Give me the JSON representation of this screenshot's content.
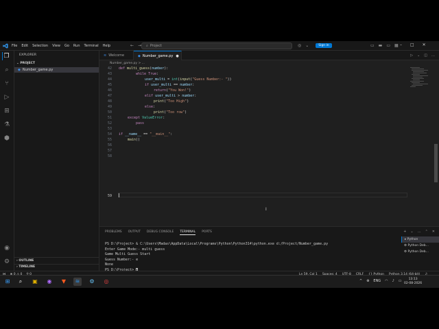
{
  "menu": [
    "File",
    "Edit",
    "Selection",
    "View",
    "Go",
    "Run",
    "Terminal",
    "Help"
  ],
  "search_placeholder": "Project",
  "signin_label": "Sign in",
  "explorer_title": "EXPLORER",
  "folder_name": "PROJECT",
  "file_name": "Number_game.py",
  "outline_label": "OUTLINE",
  "timeline_label": "TIMELINE",
  "tabs": [
    {
      "label": "Welcome"
    },
    {
      "label": "Number_game.py",
      "dirty": "●"
    }
  ],
  "breadcrumb": "Number_game.py > ...",
  "code": {
    "lines": [
      "42",
      "43",
      "44",
      "45",
      "46",
      "47",
      "48",
      "49",
      "50",
      "51",
      "52",
      "53",
      "54",
      "55",
      "56",
      "57",
      "58",
      "59"
    ],
    "l42": [
      "def ",
      "multi_guess",
      "(",
      "number",
      "):"
    ],
    "l43": [
      "while ",
      "True",
      ":"
    ],
    "l44": [
      "user_multi",
      " = ",
      "int",
      "(",
      "input",
      "(",
      "\"Guess Number:- \"",
      "))"
    ],
    "l45": [
      "if ",
      "user_multi",
      " == ",
      "number",
      ":"
    ],
    "l46": [
      "return",
      "(",
      "\"You Won!\"",
      ")"
    ],
    "l47": [
      "elif ",
      "user_multi",
      " > ",
      "number",
      ":"
    ],
    "l48": [
      "print",
      "(",
      "\"Too High\"",
      ")"
    ],
    "l49": [
      "else",
      ":"
    ],
    "l50": [
      "print",
      "(",
      "\"Too row\"",
      ")"
    ],
    "l51": [
      "except ",
      "ValueError",
      ":"
    ],
    "l52": [
      "pass"
    ],
    "l54": [
      "if ",
      "__name__",
      " == ",
      "\"__main__\"",
      ":"
    ],
    "l55": [
      "main",
      "()"
    ]
  },
  "panel_tabs": [
    "PROBLEMS",
    "OUTPUT",
    "DEBUG CONSOLE",
    "TERMINAL",
    "PORTS"
  ],
  "terminal_lines": [
    "PS D:\\Project> & C:\\Users\\Madas\\AppData\\Local\\Programs\\Python\\Python314\\python.exe d:/Project/Number_game.py",
    "Enter Game Mode:- multi guess",
    "Game Multi Guess Start",
    "Guess Number:- e",
    "None",
    "PS D:\\Project> "
  ],
  "terminal_list": [
    "Python",
    "Python Deb...",
    "Python Deb..."
  ],
  "status": {
    "errors": "0",
    "warnings": "0",
    "position": "Ln 59, Col 1",
    "spaces": "Spaces: 4",
    "encoding": "UTF-8",
    "eol": "CRLF",
    "language": "Python",
    "interpreter": "Python 3.14 (64-bit)"
  },
  "tray": {
    "language": "ENG",
    "time": "13:13",
    "date": "02-08-2026"
  },
  "colors": {
    "accent": "#0078d4",
    "keyword": "#c586c0",
    "function": "#dcdcaa",
    "string": "#ce9178",
    "variable": "#9cdcfe"
  }
}
